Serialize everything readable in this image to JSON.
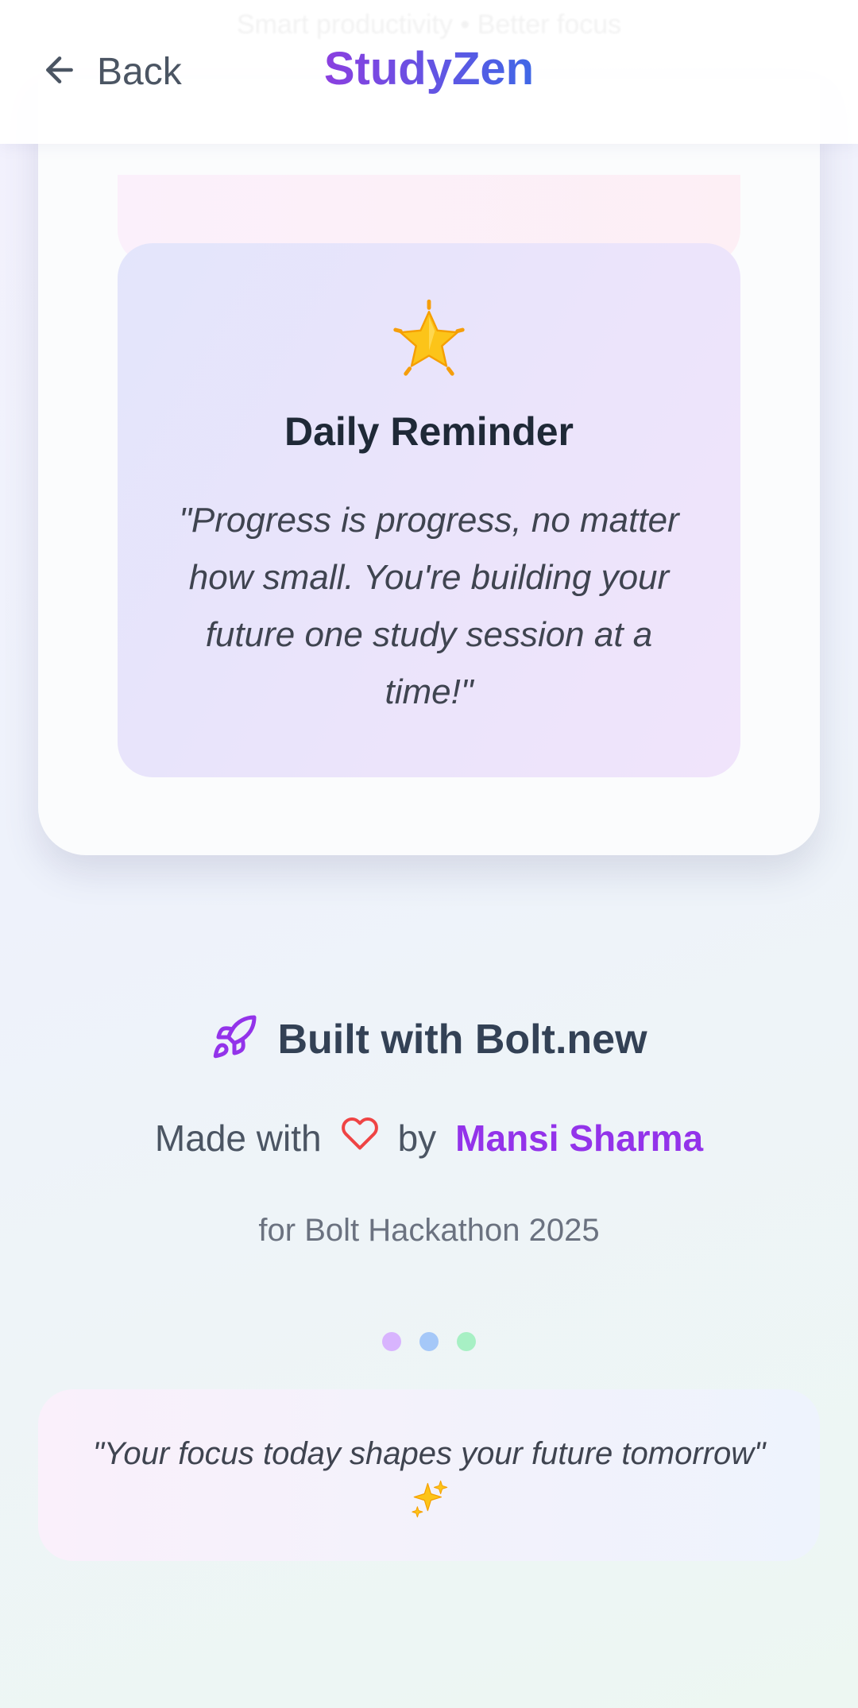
{
  "header": {
    "ghost_text": "Smart productivity • Better focus",
    "back_label": "Back",
    "brand": "StudyZen"
  },
  "reminder": {
    "icon": "star-emoji-icon",
    "title": "Daily Reminder",
    "quote": "\"Progress is progress, no matter how small. You're building your future one study session at a time!\""
  },
  "footer": {
    "built_icon": "rocket-icon",
    "built_text": "Built with Bolt.new",
    "made_prefix": "Made with",
    "made_icon": "heart-icon",
    "made_by": "by",
    "author": "Mansi Sharma",
    "event": "for Bolt Hackathon 2025",
    "dot_colors": [
      "#d8b4fe",
      "#a5c8f8",
      "#a7f0c4"
    ],
    "motto": "\"Your focus today shapes your future tomorrow\"",
    "motto_icon": "sparkles-icon"
  },
  "colors": {
    "brand_start": "#8b3fe0",
    "brand_end": "#3f67e6",
    "author": "#9333ea",
    "heart": "#ef4444",
    "rocket": "#9333ea"
  }
}
